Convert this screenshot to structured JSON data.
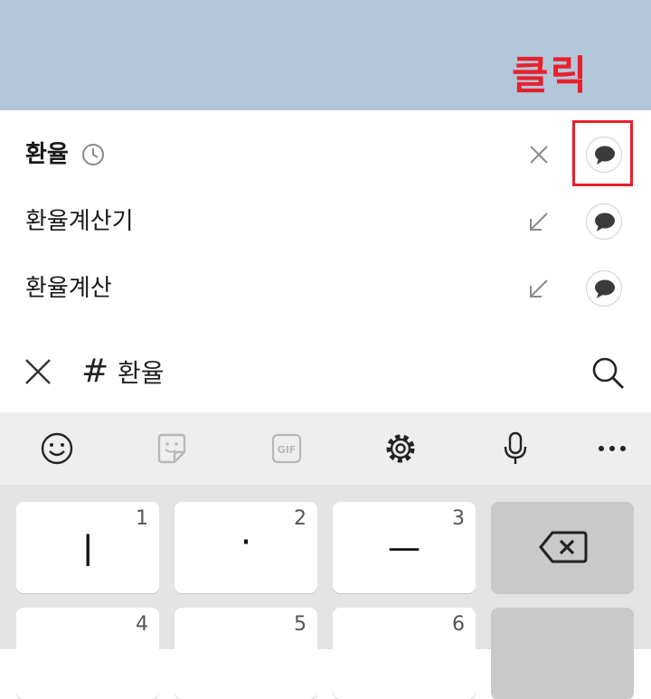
{
  "annotation": {
    "callout_text": "클릭",
    "highlight_color": "#e8202b"
  },
  "suggestions": [
    {
      "label": "환율",
      "history_icon": "clock-icon",
      "action_icon": "close-icon",
      "bubble_icon": "chat-bubble-icon"
    },
    {
      "label": "환율계산기",
      "action_icon": "arrow-up-left-icon",
      "bubble_icon": "chat-bubble-icon"
    },
    {
      "label": "환율계산",
      "action_icon": "arrow-up-left-icon",
      "bubble_icon": "chat-bubble-icon"
    }
  ],
  "input": {
    "clear_icon": "close-icon",
    "hash": "#",
    "query": "환율",
    "search_icon": "search-icon"
  },
  "keyboard_toolbar": [
    "emoji-icon",
    "sticker-icon",
    "gif-icon",
    "settings-icon",
    "microphone-icon",
    "more-icon"
  ],
  "keys": [
    {
      "num": "1",
      "symbol": "ㅣ"
    },
    {
      "num": "2",
      "symbol": "·"
    },
    {
      "num": "3",
      "symbol": "ㅡ"
    },
    {
      "icon": "backspace-icon"
    },
    {
      "num": "4"
    },
    {
      "num": "5"
    },
    {
      "num": "6"
    }
  ],
  "colors": {
    "header_bg": "#b3c7da",
    "accent_red": "#e8202b"
  }
}
